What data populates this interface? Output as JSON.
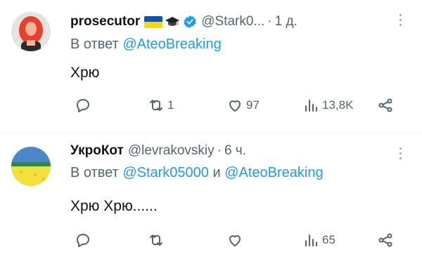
{
  "tweets": [
    {
      "name": "prosecutor",
      "handle": "@Stark0...",
      "time": "1 д.",
      "reply_prefix": "В ответ",
      "mention1": "@AteoBreaking",
      "mention_joiner": "",
      "mention2": "",
      "text": "Хрю",
      "retweets": "1",
      "likes": "97",
      "views": "13,8K",
      "avatar_colors": [
        "#e8412b",
        "#f7b39b",
        "#e7e2db"
      ]
    },
    {
      "name": "УкроКот",
      "handle": "@levrakovskiy",
      "time": "6 ч.",
      "reply_prefix": "В ответ",
      "mention1": "@Stark05000",
      "mention_joiner": "и",
      "mention2": "@AteoBreaking",
      "text": "Хрю Хрю......",
      "retweets": "",
      "likes": "",
      "views": "65",
      "avatar_colors": [
        "#4a86c9",
        "#f2e03c",
        "#2f8a3c"
      ]
    }
  ],
  "dot_separator": "·",
  "icons": [
    "reply-icon",
    "retweet-icon",
    "like-icon",
    "views-icon",
    "share-icon",
    "more-icon",
    "verified-icon",
    "ukraine-flag-icon",
    "graduation-cap-icon"
  ],
  "colors": {
    "accent": "#1d9bf0",
    "muted": "#536471",
    "text": "#0f1419"
  }
}
